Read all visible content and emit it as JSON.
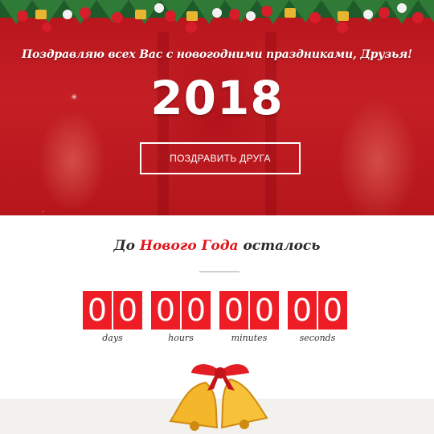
{
  "hero": {
    "greeting": "Поздравляю всех Вас с новогодними праздниками, Друзья!",
    "year": "2018",
    "button_label": "ПОЗДРАВИТЬ ДРУГА"
  },
  "countdown": {
    "heading_prefix": "До",
    "heading_accent": "Нового Года",
    "heading_suffix": "осталось",
    "units": [
      {
        "digits": [
          "0",
          "0"
        ],
        "label": "days"
      },
      {
        "digits": [
          "0",
          "0"
        ],
        "label": "hours"
      },
      {
        "digits": [
          "0",
          "0"
        ],
        "label": "minutes"
      },
      {
        "digits": [
          "0",
          "0"
        ],
        "label": "seconds"
      }
    ]
  },
  "colors": {
    "hero_red": "#c41f25",
    "timer_red": "#ee1c24",
    "accent_red": "#e0161c"
  },
  "icons": [
    "garland-icon",
    "bells-icon",
    "sparkle-icon"
  ]
}
